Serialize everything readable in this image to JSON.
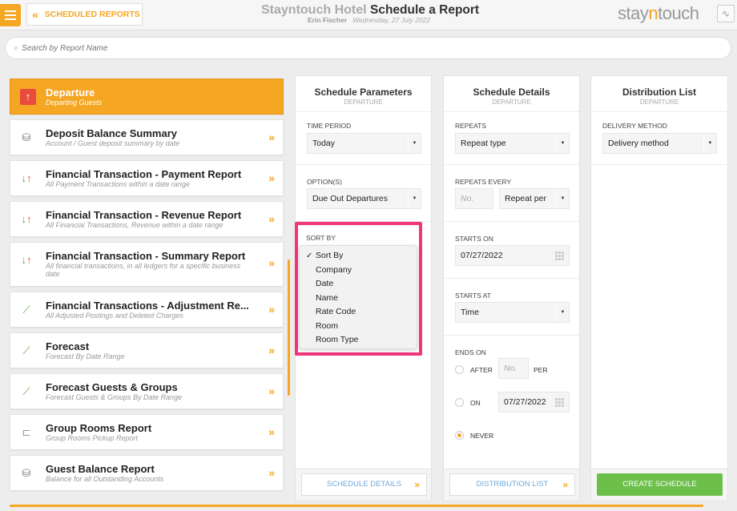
{
  "header": {
    "back_label": "SCHEDULED REPORTS",
    "hotel_name": "Stayntouch Hotel",
    "page_title": "Schedule a Report",
    "user_name": "Erin Fischer",
    "date": "Wednesday, 27 July 2022",
    "logo_left": "stay",
    "logo_mid": "n",
    "logo_right": "touch"
  },
  "search": {
    "placeholder": "Search by Report Name"
  },
  "reports": [
    {
      "title": "Departure",
      "subtitle": "Departing Guests",
      "icon": "arrow-up-icon",
      "active": true
    },
    {
      "title": "Deposit Balance Summary",
      "subtitle": "Account / Guest deposit summary by date",
      "icon": "coins-icon"
    },
    {
      "title": "Financial Transaction - Payment Report",
      "subtitle": "All Payment Transactions within a date range",
      "icon": "transfer-arrows-icon"
    },
    {
      "title": "Financial Transaction - Revenue Report",
      "subtitle": "All Financial Transactions, Revenue within a date range",
      "icon": "transfer-arrows-icon"
    },
    {
      "title": "Financial Transaction - Summary Report",
      "subtitle": "All financial transactions, in all ledgers for a specific business date",
      "icon": "transfer-arrows-icon"
    },
    {
      "title": "Financial Transactions - Adjustment Re...",
      "subtitle": "All Adjusted Postings and Deleted Charges",
      "icon": "trend-chart-icon"
    },
    {
      "title": "Forecast",
      "subtitle": "Forecast By Date Range",
      "icon": "trend-chart-icon"
    },
    {
      "title": "Forecast Guests & Groups",
      "subtitle": "Forecast Guests & Groups By Date Range",
      "icon": "trend-chart-icon"
    },
    {
      "title": "Group Rooms Report",
      "subtitle": "Group Rooms Pickup Report",
      "icon": "bed-icon"
    },
    {
      "title": "Guest Balance Report",
      "subtitle": "Balance for all Outstanding Accounts",
      "icon": "coins-icon"
    }
  ],
  "params": {
    "title": "Schedule Parameters",
    "sub": "DEPARTURE",
    "time_period_label": "TIME PERIOD",
    "time_period_value": "Today",
    "options_label": "OPTION(S)",
    "options_value": "Due Out Departures",
    "sort_label": "SORT BY",
    "sort_options": [
      "Sort By",
      "Company",
      "Date",
      "Name",
      "Rate Code",
      "Room",
      "Room Type"
    ],
    "sort_selected": "Sort By",
    "footer_button": "SCHEDULE DETAILS"
  },
  "details": {
    "title": "Schedule Details",
    "sub": "DEPARTURE",
    "repeats_label": "REPEATS",
    "repeats_value": "Repeat type",
    "every_label": "REPEATS EVERY",
    "every_no_placeholder": "No.",
    "every_per_value": "Repeat per",
    "starts_on_label": "STARTS ON",
    "starts_on_value": "07/27/2022",
    "starts_at_label": "STARTS AT",
    "starts_at_value": "Time",
    "ends_on_label": "ENDS ON",
    "after_label": "AFTER",
    "after_placeholder": "No.",
    "per_label": "PER",
    "on_label": "ON",
    "on_value": "07/27/2022",
    "never_label": "NEVER",
    "footer_button": "DISTRIBUTION LIST"
  },
  "distribution": {
    "title": "Distribution List",
    "sub": "DEPARTURE",
    "delivery_label": "DELIVERY METHOD",
    "delivery_value": "Delivery method",
    "create_button": "CREATE SCHEDULE"
  },
  "colors": {
    "accent": "#f5a623",
    "create": "#6cc04a",
    "highlight": "#f0367a",
    "link": "#6fa9dc"
  }
}
